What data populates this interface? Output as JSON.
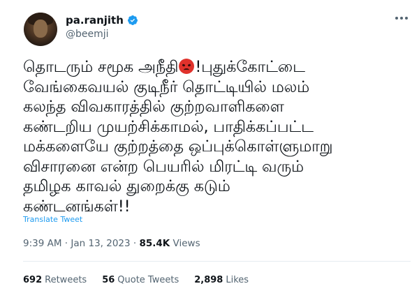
{
  "author": {
    "name": "pa.ranjith",
    "handle": "@beemji"
  },
  "tweet": {
    "text_part1": "தொடரும் சமூக அநீதி",
    "text_part2": "!புதுக்கோட்டை\nவேங்கைவயல் குடிநீர் தொட்டியில் மலம்\nகலந்த விவகாரத்தில் குற்றவாளிகளை\nகண்டறிய முயற்சிக்காமல், பாதிக்கப்பட்ட\nமக்களையே குற்றத்தை ஒப்புக்கொள்ளுமாறு\nவிசாரனை என்ற பெயரில் மிரட்டி வரும்\nதமிழக காவல் துறைக்கு கடும்\nகண்டனங்கள்!!",
    "translate_label": "Translate Tweet"
  },
  "meta": {
    "time": "9:39 AM",
    "separator1": " · ",
    "date": "Jan 13, 2023",
    "separator2": " · ",
    "views_count": "85.4K",
    "views_label": " Views"
  },
  "stats": {
    "retweets_count": "692",
    "retweets_label": "Retweets",
    "quotes_count": "56",
    "quotes_label": "Quote Tweets",
    "likes_count": "2,898",
    "likes_label": "Likes"
  },
  "colors": {
    "accent": "#1d9bf0",
    "secondary_text": "#536471",
    "primary_text": "#0f1419"
  },
  "icons": {
    "verified": "verified-badge-icon",
    "more": "more-options-icon",
    "emoji": "angry-face-emoji"
  }
}
